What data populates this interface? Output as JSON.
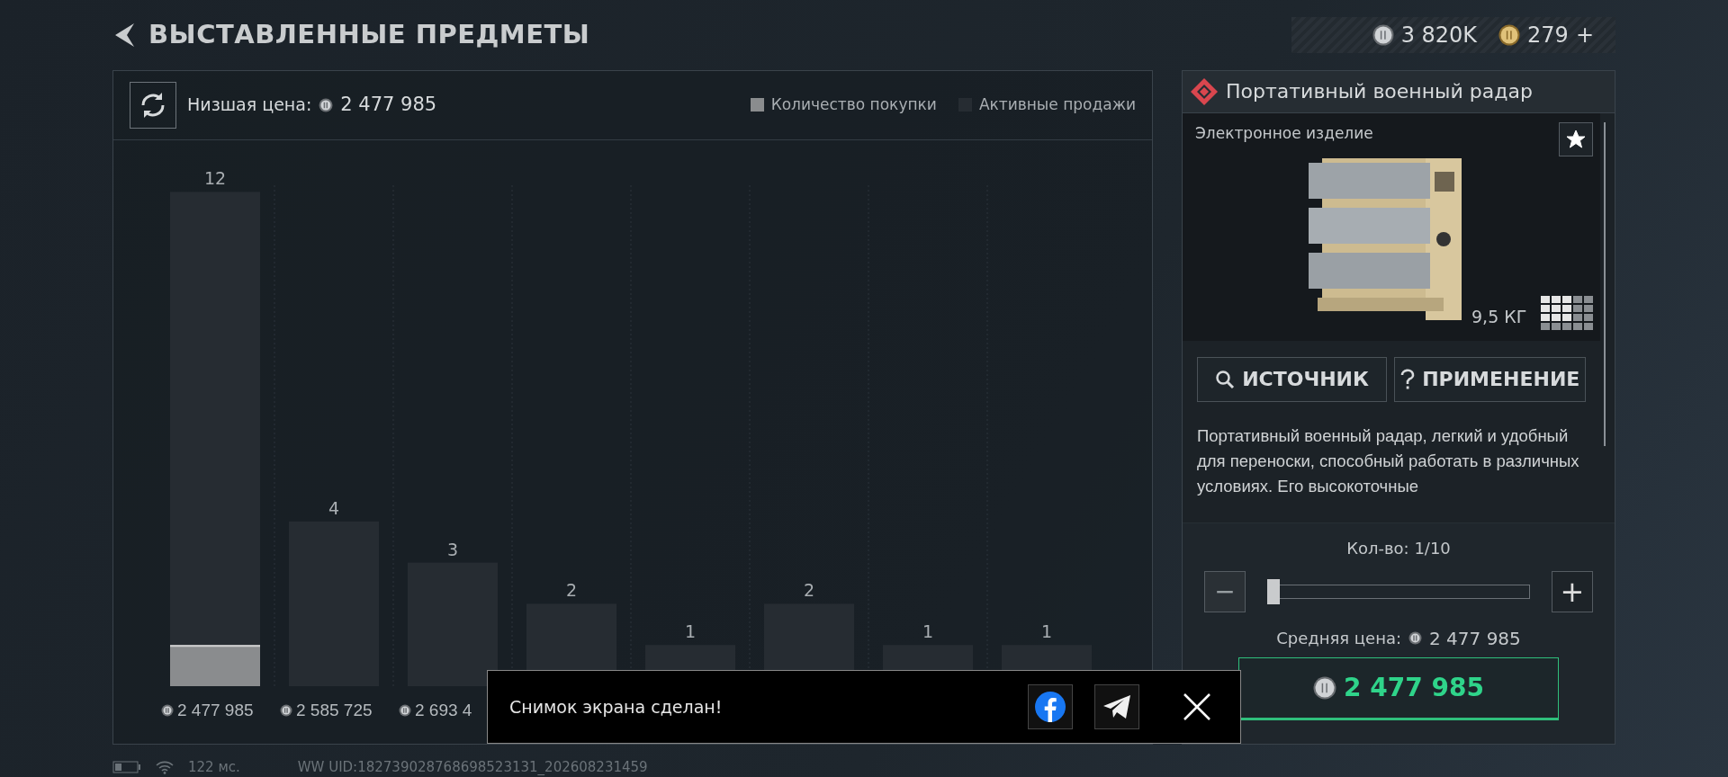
{
  "header": {
    "title": "ВЫСТАВЛЕННЫЕ ПРЕДМЕТЫ"
  },
  "currency": [
    {
      "kind": "silver",
      "amount": "3 820K"
    },
    {
      "kind": "gold",
      "amount": "279"
    }
  ],
  "add_label": "+",
  "chart_panel": {
    "lowest_price_label": "Низшая цена:",
    "lowest_price": "2 477 985",
    "chart_data": {
      "type": "bar",
      "categories": [
        "2 477 985",
        "2 585 725",
        "2 693 4",
        null,
        null,
        null,
        null,
        null
      ],
      "stacked": false,
      "series": [
        {
          "name": "Количество покупки",
          "color": "#8a8c8e",
          "values": [
            1,
            0,
            0,
            0,
            0,
            0,
            0,
            0
          ],
          "value_labels": [
            null,
            null,
            null,
            null,
            null,
            null,
            null,
            null
          ]
        },
        {
          "name": "Активные продажи",
          "color": "#262c32",
          "values": [
            12,
            4,
            3,
            2,
            1,
            2,
            1,
            1
          ],
          "value_labels": [
            "12",
            "4",
            "3",
            "2",
            "1",
            "2",
            "1",
            "1"
          ]
        }
      ]
    }
  },
  "item": {
    "name": "Портативный военный радар",
    "category": "Электронное изделие",
    "favorite": true,
    "weight": "9,5 КГ",
    "buttons": [
      {
        "kind": "search",
        "label": "ИСТОЧНИК"
      },
      {
        "kind": "help",
        "label": "ПРИМЕНЕНИЕ"
      }
    ],
    "description": "Портативный военный радар, легкий и удобный для переноски, способный работать в различных условиях. Его высокоточные",
    "quantity_label": "Кол-во: 1/10",
    "quantity": {
      "level": 0
    },
    "minus": "−",
    "plus": "+",
    "average_label": "Средняя цена:",
    "average_price": "2 477 985",
    "buy_price": "2 477 985"
  },
  "toast": {
    "message": "Снимок экрана сделан!"
  },
  "status_bar": {
    "ping": "122 мс.",
    "uid": "WW UID:182739028768698523131_202608231459"
  }
}
